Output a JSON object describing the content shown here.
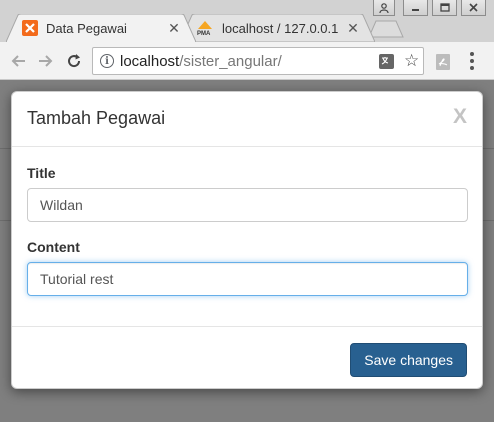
{
  "browser": {
    "tabs": [
      {
        "title": "Data Pegawai",
        "favicon": "xampp-icon",
        "active": true
      },
      {
        "title": "localhost / 127.0.0.1 /",
        "favicon": "phpmyadmin-icon",
        "active": false
      }
    ],
    "address_host": "localhost",
    "address_path": "/sister_angular/",
    "window_controls": [
      "user-icon",
      "minimize-icon",
      "restore-icon",
      "close-icon"
    ]
  },
  "modal": {
    "title": "Tambah Pegawai",
    "close_label": "X",
    "fields": [
      {
        "label": "Title",
        "value": "Wildan"
      },
      {
        "label": "Content",
        "value": "Tutorial rest"
      }
    ],
    "save_label": "Save changes"
  },
  "colors": {
    "primary_button": "#286090",
    "focus_border": "#66afe9",
    "favicon_xampp": "#f36b1c"
  }
}
